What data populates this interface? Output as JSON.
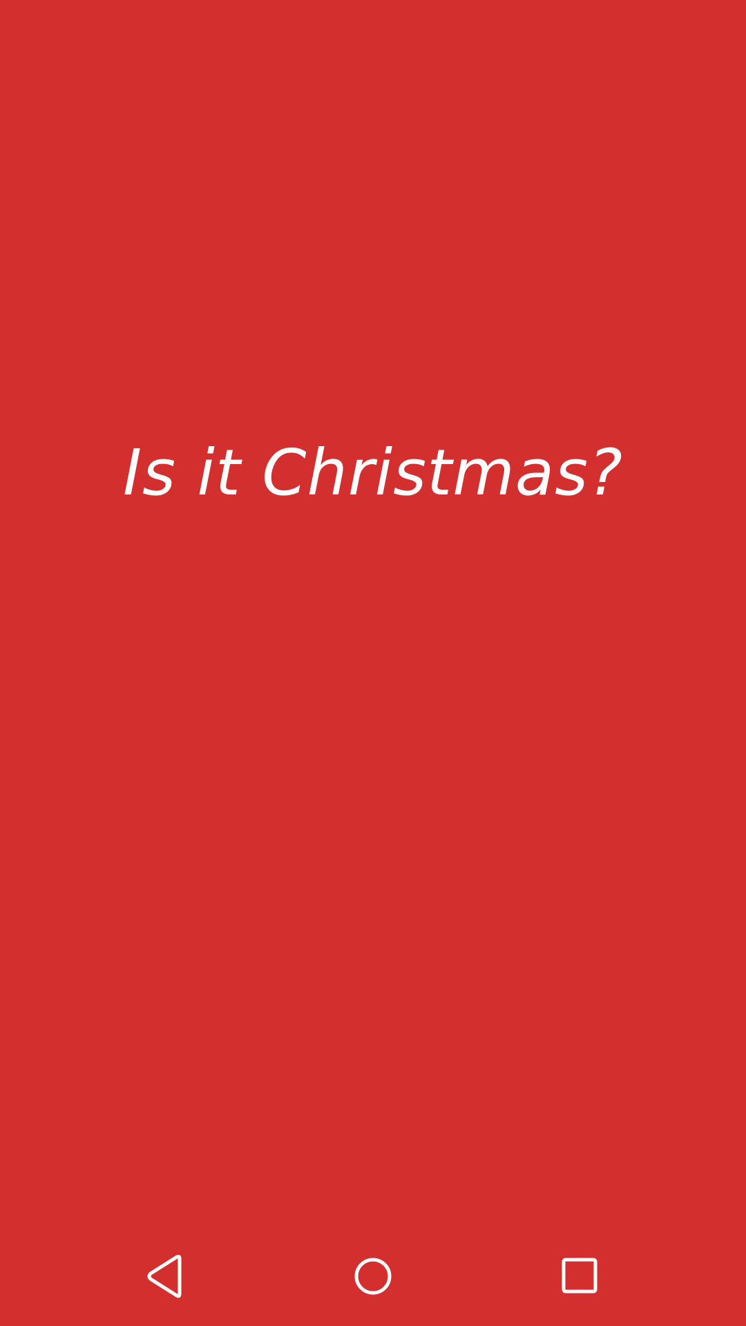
{
  "main": {
    "question": "Is it Christmas?"
  },
  "colors": {
    "background": "#d32f2f",
    "text": "#ffffff"
  },
  "navbar": {
    "back_icon": "back-triangle-icon",
    "home_icon": "home-circle-icon",
    "recents_icon": "recents-square-icon"
  }
}
